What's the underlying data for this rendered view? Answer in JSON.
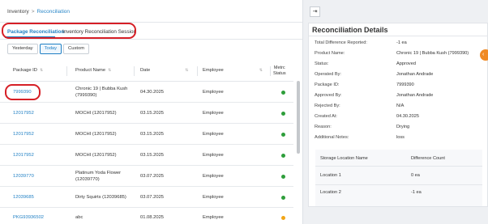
{
  "breadcrumb": {
    "root": "Inventory",
    "separator": ">",
    "current": "Reconciliation"
  },
  "tabs": [
    {
      "label": "Package Reconciliation",
      "active": true
    },
    {
      "label": "Inventory Reconciliation Session",
      "active": false
    }
  ],
  "filters": [
    {
      "label": "Yesterday",
      "active": false
    },
    {
      "label": "Today",
      "active": true
    },
    {
      "label": "Custom",
      "active": false
    }
  ],
  "table": {
    "headers": {
      "package_id": "Package ID",
      "product_name": "Product Name",
      "date": "Date",
      "employee": "Employee",
      "metrc_status": [
        "Metrc",
        "Status"
      ]
    },
    "rows": [
      {
        "package_id": "7999390",
        "product_name": [
          "Chronic 19 | Bubba Kush",
          "(7999390)"
        ],
        "date": "04.30.2025",
        "employee": "Employee",
        "status_color": "#2e9e3b"
      },
      {
        "package_id": "12017952",
        "product_name": [
          "MOCHI (12017952)"
        ],
        "date": "03.15.2025",
        "employee": "Employee",
        "status_color": "#2e9e3b"
      },
      {
        "package_id": "12017952",
        "product_name": [
          "MOCHI (12017952)"
        ],
        "date": "03.15.2025",
        "employee": "Employee",
        "status_color": "#2e9e3b"
      },
      {
        "package_id": "12017952",
        "product_name": [
          "MOCHI (12017952)"
        ],
        "date": "03.15.2025",
        "employee": "Employee",
        "status_color": "#2e9e3b"
      },
      {
        "package_id": "12039770",
        "product_name": [
          "Platinum Yoda Flower",
          "(12039770)"
        ],
        "date": "03.07.2025",
        "employee": "Employee",
        "status_color": "#2e9e3b"
      },
      {
        "package_id": "12039685",
        "product_name": [
          "Dirty Squirts (12039685)"
        ],
        "date": "03.07.2025",
        "employee": "Employee",
        "status_color": "#2e9e3b"
      },
      {
        "package_id": "PKG93936502",
        "product_name": [
          "abc"
        ],
        "date": "01.08.2025",
        "employee": "Employee",
        "status_color": "#f2a516"
      }
    ]
  },
  "details": {
    "title": "Reconciliation Details",
    "fields": [
      {
        "label": "Total Difference Reported:",
        "value": "-1 ea"
      },
      {
        "label": "Product Name:",
        "value": "Chronic 19 | Bubba Kush (7999390)"
      },
      {
        "label": "Status:",
        "value": "Approved"
      },
      {
        "label": "Operated By:",
        "value": "Jonathan Andrade"
      },
      {
        "label": "Package ID:",
        "value": "7999390"
      },
      {
        "label": "Approved By:",
        "value": "Jonathan Andrade"
      },
      {
        "label": "Rejected By:",
        "value": "N/A"
      },
      {
        "label": "Created At:",
        "value": "04.30.2025"
      },
      {
        "label": "Reason:",
        "value": "Drying"
      },
      {
        "label": "Additional Notes:",
        "value": "loss"
      }
    ],
    "locations": {
      "headers": {
        "name": "Storage Location Name",
        "count": "Difference Count"
      },
      "rows": [
        {
          "name": "Location 1",
          "count": "0 ea"
        },
        {
          "name": "Location 2",
          "count": "-1 ea"
        }
      ]
    }
  },
  "icons": {
    "collapse": "collapse-panel-icon",
    "orange": "chevron-left-icon"
  }
}
